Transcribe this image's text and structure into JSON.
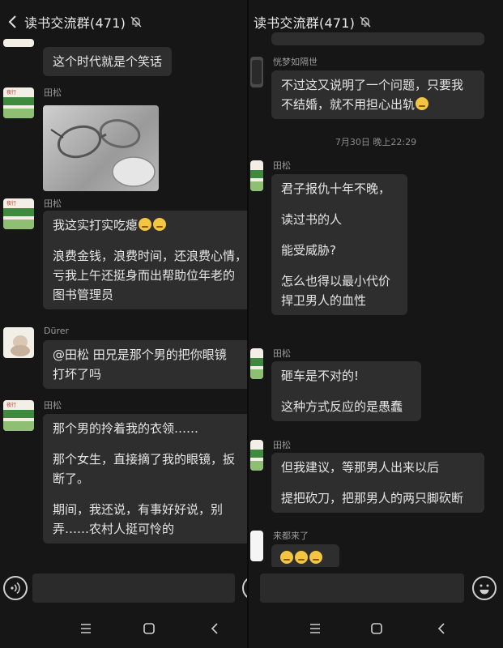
{
  "left": {
    "header": {
      "title": "读书交流群(471)"
    },
    "messages": [
      {
        "text": "这个时代就是个笑话"
      },
      {
        "name": "田松"
      },
      {
        "name": "田松",
        "blocks": [
          [
            "我这实打实吃瘪"
          ],
          [
            "浪费金钱，浪费时间，还浪费心情，",
            "亏我上午还挺身而出帮助位年老的",
            "图书管理员"
          ]
        ]
      },
      {
        "name": "Dürer",
        "lines": [
          "@田松  田兄是那个男的把你眼镜",
          "打坏了吗"
        ]
      },
      {
        "name": "田松",
        "blocks": [
          [
            "那个男的拎着我的衣领……"
          ],
          [
            "那个女生，直接摘了我的眼镜，扳",
            "断了。"
          ],
          [
            "期间，我还说，有事好好说，别",
            "弄……农村人挺可怜的"
          ]
        ]
      }
    ]
  },
  "right": {
    "header": {
      "title": "读书交流群(471)"
    },
    "messages": [
      {
        "name": "恍梦如隔世",
        "lines": [
          "不过这又说明了一个问题，只要我",
          "不结婚，就不用担心出轨"
        ]
      },
      {
        "time": "7月30日 晚上22:29"
      },
      {
        "name": "田松",
        "blocks": [
          [
            "君子报仇十年不晚，"
          ],
          [
            "读过书的人"
          ],
          [
            "能受威胁?"
          ],
          [
            "怎么也得以最小代价",
            "捍卫男人的血性"
          ]
        ]
      },
      {
        "name": "田松",
        "blocks": [
          [
            "砸车是不对的!"
          ],
          [
            "这种方式反应的是愚蠢"
          ]
        ]
      },
      {
        "name": "田松",
        "blocks": [
          [
            "但我建议，等那男人出来以后"
          ],
          [
            "提把砍刀，把那男人的两只脚砍断"
          ]
        ]
      },
      {
        "name": "来都来了"
      }
    ]
  }
}
